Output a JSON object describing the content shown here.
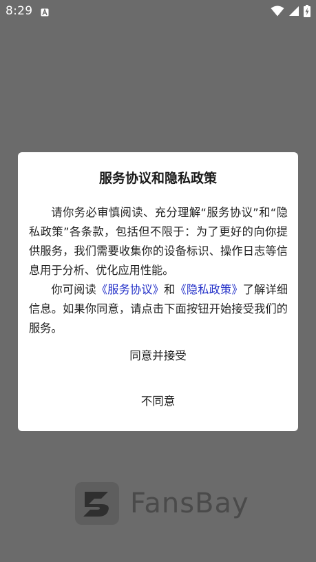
{
  "status_bar": {
    "time": "8:29",
    "icons": [
      "notification-a-icon",
      "wifi-icon",
      "signal-icon",
      "battery-charging-icon"
    ]
  },
  "background": {
    "app_name": "FansBay",
    "overlay_color": "#6b6b6b"
  },
  "dialog": {
    "title": "服务协议和隐私政策",
    "paragraph1": "请你务必审慎阅读、充分理解“服务协议”和“隐私政策”各条款，包括但不限于：为了更好的向你提供服务，我们需要收集你的设备标识、操作日志等信息用于分析、优化应用性能。",
    "paragraph2": {
      "prefix": "你可阅读",
      "link_service": "《服务协议》",
      "middle": "和",
      "link_privacy": "《隐私政策》",
      "suffix": "了解详细信息。如果你同意，请点击下面按钮开始接受我们的服务。"
    },
    "accept_label": "同意并接受",
    "decline_label": "不同意",
    "link_color": "#2330c8"
  }
}
